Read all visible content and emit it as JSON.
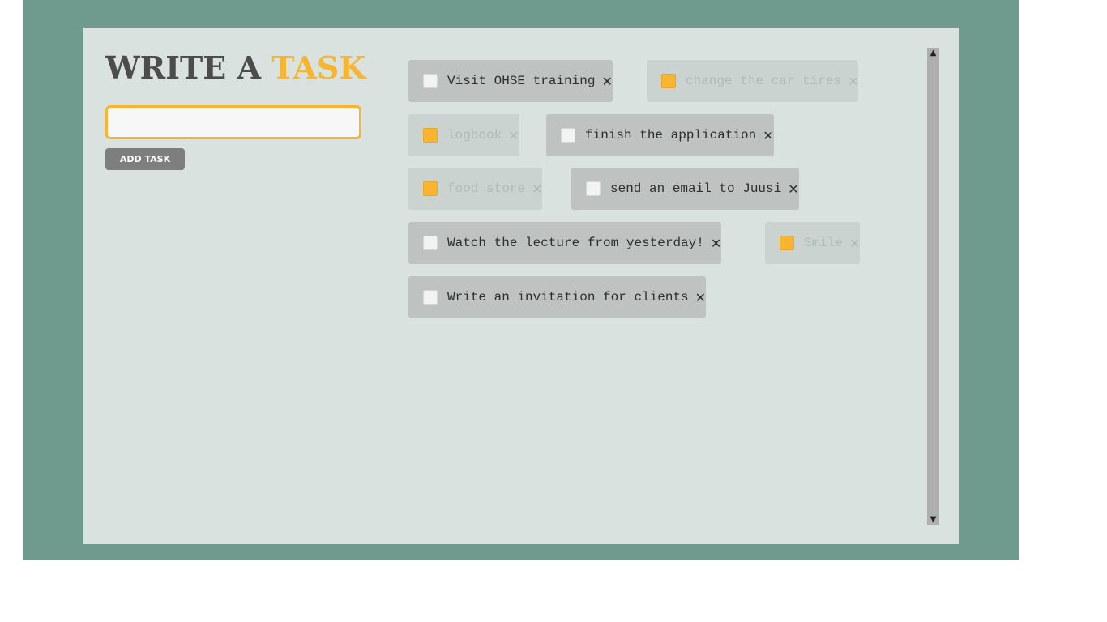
{
  "header": {
    "title_part1": "WRITE A",
    "title_part2": "TASK"
  },
  "form": {
    "input_value": "",
    "add_button_label": "ADD TASK"
  },
  "tasks": [
    {
      "text": "Visit OHSE training",
      "done": false
    },
    {
      "text": "change the car tires",
      "done": true
    },
    {
      "text": "logbook",
      "done": true
    },
    {
      "text": "finish the application",
      "done": false
    },
    {
      "text": "food store",
      "done": true
    },
    {
      "text": "send an email to Juusi",
      "done": false
    },
    {
      "text": "Watch the lecture from yesterday!",
      "done": false
    },
    {
      "text": "Smile",
      "done": true
    },
    {
      "text": "Write an invitation for clients",
      "done": false
    }
  ],
  "icons": {
    "delete": "close-icon",
    "scroll_up": "chevron-up-icon",
    "scroll_down": "chevron-down-icon"
  },
  "colors": {
    "background": "#6f9b8f",
    "card": "#dae2df",
    "accent": "#f7b532",
    "chip": "#bec2c1",
    "chip_done": "#cbd3d0",
    "button": "#7e7e7e"
  }
}
